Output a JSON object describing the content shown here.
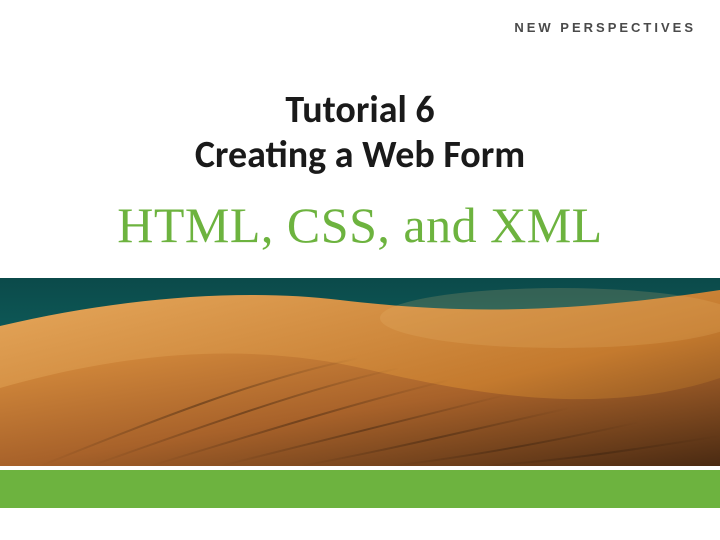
{
  "brand": "NEW PERSPECTIVES",
  "title": {
    "line1": "Tutorial 6",
    "line2": "Creating a Web Form"
  },
  "subtitle": "HTML, CSS, and XML",
  "colors": {
    "accent_green": "#6db33f",
    "text_dark": "#1a1a1a",
    "brand_gray": "#4a4a4a"
  }
}
